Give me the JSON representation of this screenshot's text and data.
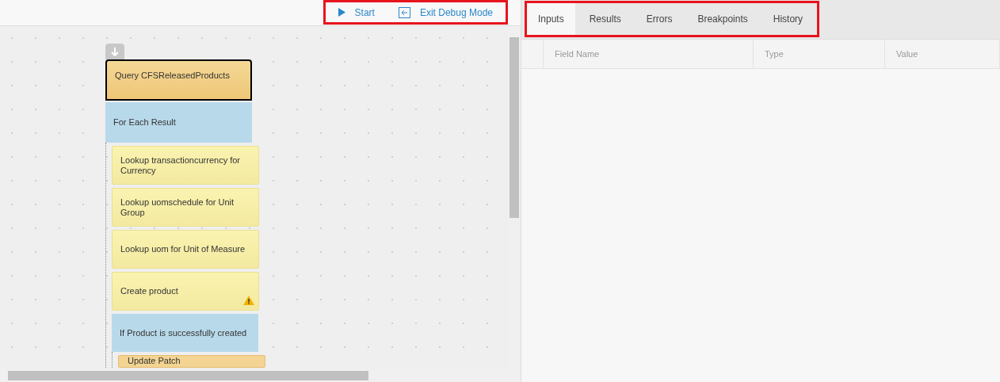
{
  "toolbar": {
    "actions": [
      {
        "kind": "play",
        "label": "Start"
      },
      {
        "kind": "exit",
        "label": "Exit Debug Mode"
      }
    ]
  },
  "flow": {
    "blocks": [
      {
        "kind": "query",
        "label": "Query CFSReleasedProducts"
      },
      {
        "kind": "loop",
        "label": "For Each Result",
        "children": [
          {
            "kind": "action",
            "label": "Lookup transactioncurrency for Currency",
            "warning": false
          },
          {
            "kind": "action",
            "label": "Lookup uomschedule for Unit Group",
            "warning": false
          },
          {
            "kind": "action",
            "label": "Lookup uom for Unit of Measure",
            "warning": false
          },
          {
            "kind": "action",
            "label": "Create product",
            "warning": true
          },
          {
            "kind": "condition",
            "label": "If Product is successfully created",
            "children": [
              {
                "kind": "update",
                "label": "Update Patch",
                "warning": false
              }
            ]
          }
        ]
      }
    ]
  },
  "debug_panel": {
    "tabs": [
      {
        "label": "Inputs",
        "selected": true
      },
      {
        "label": "Results",
        "selected": false
      },
      {
        "label": "Errors",
        "selected": false
      },
      {
        "label": "Breakpoints",
        "selected": false
      },
      {
        "label": "History",
        "selected": false
      }
    ],
    "table": {
      "columns": [
        "Field Name",
        "Type",
        "Value"
      ]
    }
  }
}
